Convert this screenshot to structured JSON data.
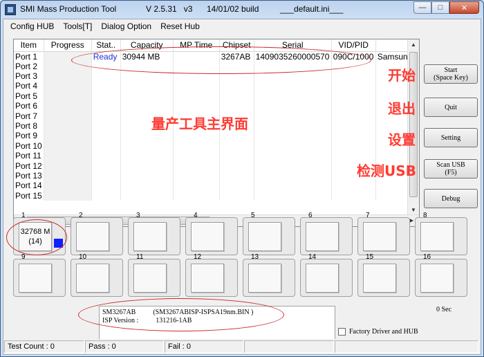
{
  "titlebar": {
    "app_name": "SMI Mass Production Tool",
    "version": "V 2.5.31   v3",
    "build": "14/01/02 build",
    "ini": "___default.ini___"
  },
  "menu": [
    "Config HUB",
    "Tools[T]",
    "Dialog Option",
    "Reset Hub"
  ],
  "grid": {
    "columns": [
      "Item",
      "Progress",
      "Stat..",
      "Capacity",
      "MP Time",
      "Chipset",
      "Serial",
      "VID/PID",
      ""
    ],
    "rows": [
      {
        "item": "Port 1",
        "status": "Ready",
        "capacity": "30944 MB",
        "mp_time": "",
        "chipset": "3267AB",
        "serial": "1409035260000570",
        "vidpid": "090C/1000",
        "vendor": "Samsun"
      },
      {
        "item": "Port 2"
      },
      {
        "item": "Port 3"
      },
      {
        "item": "Port 4"
      },
      {
        "item": "Port 5"
      },
      {
        "item": "Port 6"
      },
      {
        "item": "Port 7"
      },
      {
        "item": "Port 8"
      },
      {
        "item": "Port 9"
      },
      {
        "item": "Port 10"
      },
      {
        "item": "Port 11"
      },
      {
        "item": "Port 12"
      },
      {
        "item": "Port 13"
      },
      {
        "item": "Port 14"
      },
      {
        "item": "Port 15"
      }
    ],
    "hscroll_glyph": "III"
  },
  "buttons": {
    "start": [
      "Start",
      "(Space Key)"
    ],
    "quit": "Quit",
    "setting": "Setting",
    "scan": [
      "Scan USB",
      "(F5)"
    ],
    "debug": "Debug"
  },
  "annotations": {
    "start": "开始",
    "quit": "退出",
    "setting": "设置",
    "scan": "检测USB",
    "main": "量产工具主界面"
  },
  "slots": [
    {
      "num": "1",
      "line1": "32768 M",
      "line2": "(14)",
      "active": true
    },
    {
      "num": "2"
    },
    {
      "num": "3"
    },
    {
      "num": "4"
    },
    {
      "num": "5"
    },
    {
      "num": "6"
    },
    {
      "num": "7"
    },
    {
      "num": "8"
    },
    {
      "num": "9"
    },
    {
      "num": "10"
    },
    {
      "num": "11"
    },
    {
      "num": "12"
    },
    {
      "num": "13"
    },
    {
      "num": "14"
    },
    {
      "num": "15"
    },
    {
      "num": "16"
    }
  ],
  "info": {
    "line1": "SM3267AB          (SM3267ABISP-ISPSA19nm.BIN )",
    "line2": "ISP Version :          131216-1AB"
  },
  "timer": "0 Sec",
  "factory_checkbox": {
    "label": "Factory Driver and HUB",
    "checked": false
  },
  "status": {
    "test_count": "Test Count : 0",
    "pass": "Pass : 0",
    "fail": "Fail : 0"
  },
  "colors": {
    "annotation": "#ff3b33",
    "ready": "#1c33d1",
    "slot_indicator": "#1020ff"
  }
}
